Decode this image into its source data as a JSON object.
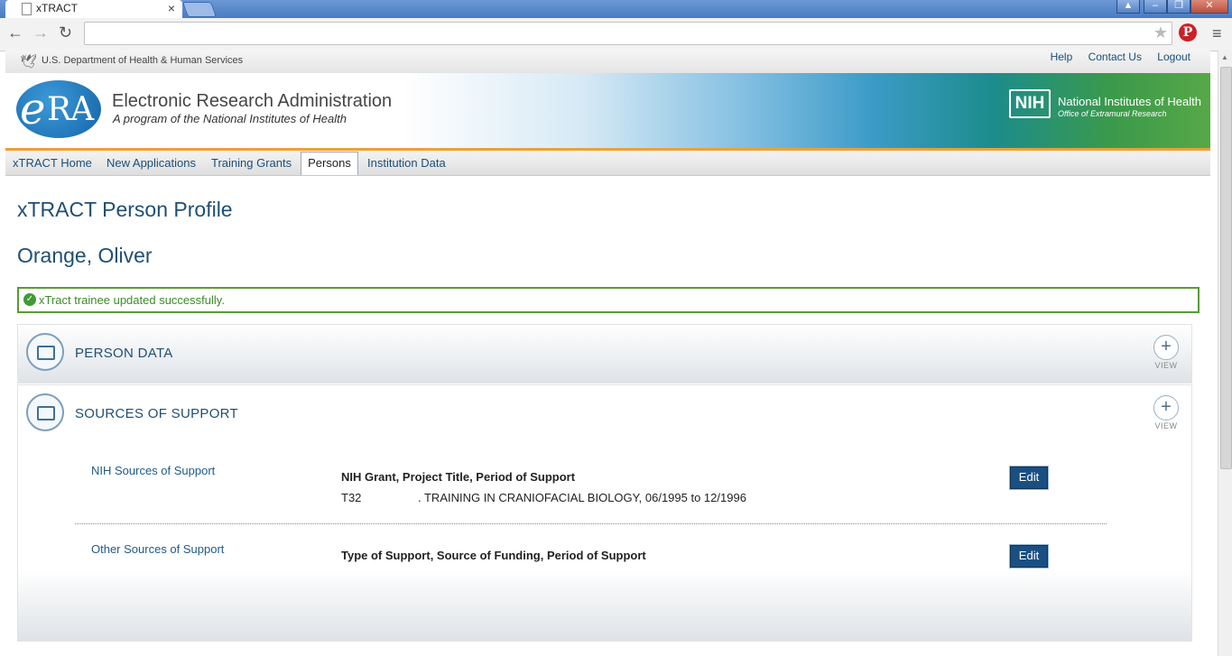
{
  "browser": {
    "tab_title": "xTRACT",
    "tab_close": "×",
    "win_controls": [
      "▲",
      "–",
      "❐",
      "✕"
    ],
    "nav_icons": [
      "back-icon",
      "forward-icon",
      "reload-icon",
      "star-icon",
      "pinterest-icon",
      "menu-icon"
    ]
  },
  "hhs": {
    "text": "U.S. Department of Health & Human Services",
    "links": [
      "Help",
      "Contact Us",
      "Logout"
    ]
  },
  "banner": {
    "title": "Electronic Research Administration",
    "subtitle": "A program of the National Institutes of Health",
    "nih_box": "NIH",
    "nih_name": "National Institutes of Health",
    "nih_sub": "Office of Extramural Research",
    "logo_e": "e",
    "logo_ra": "RA"
  },
  "nav": {
    "items": [
      "xTRACT Home",
      "New Applications",
      "Training Grants",
      "Persons",
      "Institution Data"
    ],
    "active": "Persons"
  },
  "page": {
    "title": "xTRACT Person Profile",
    "person_name": "Orange, Oliver",
    "alert": "xTract trainee updated successfully."
  },
  "sections": {
    "person_data": {
      "title": "PERSON DATA",
      "view": "VIEW"
    },
    "support": {
      "title": "SOURCES OF SUPPORT",
      "view": "VIEW",
      "nih": {
        "label": "NIH Sources of Support",
        "header": "NIH Grant, Project Title, Period of Support",
        "value_prefix": "T32",
        "value_rest": ". TRAINING IN CRANIOFACIAL BIOLOGY, 06/1995 to 12/1996",
        "edit": "Edit"
      },
      "other": {
        "label": "Other Sources of Support",
        "header": "Type of Support, Source of Funding, Period of Support",
        "edit": "Edit"
      }
    }
  },
  "colors": {
    "heading": "#1f4f74",
    "success": "#5a9a38",
    "button": "#1a4f82",
    "accent_line": "#f0a030"
  }
}
